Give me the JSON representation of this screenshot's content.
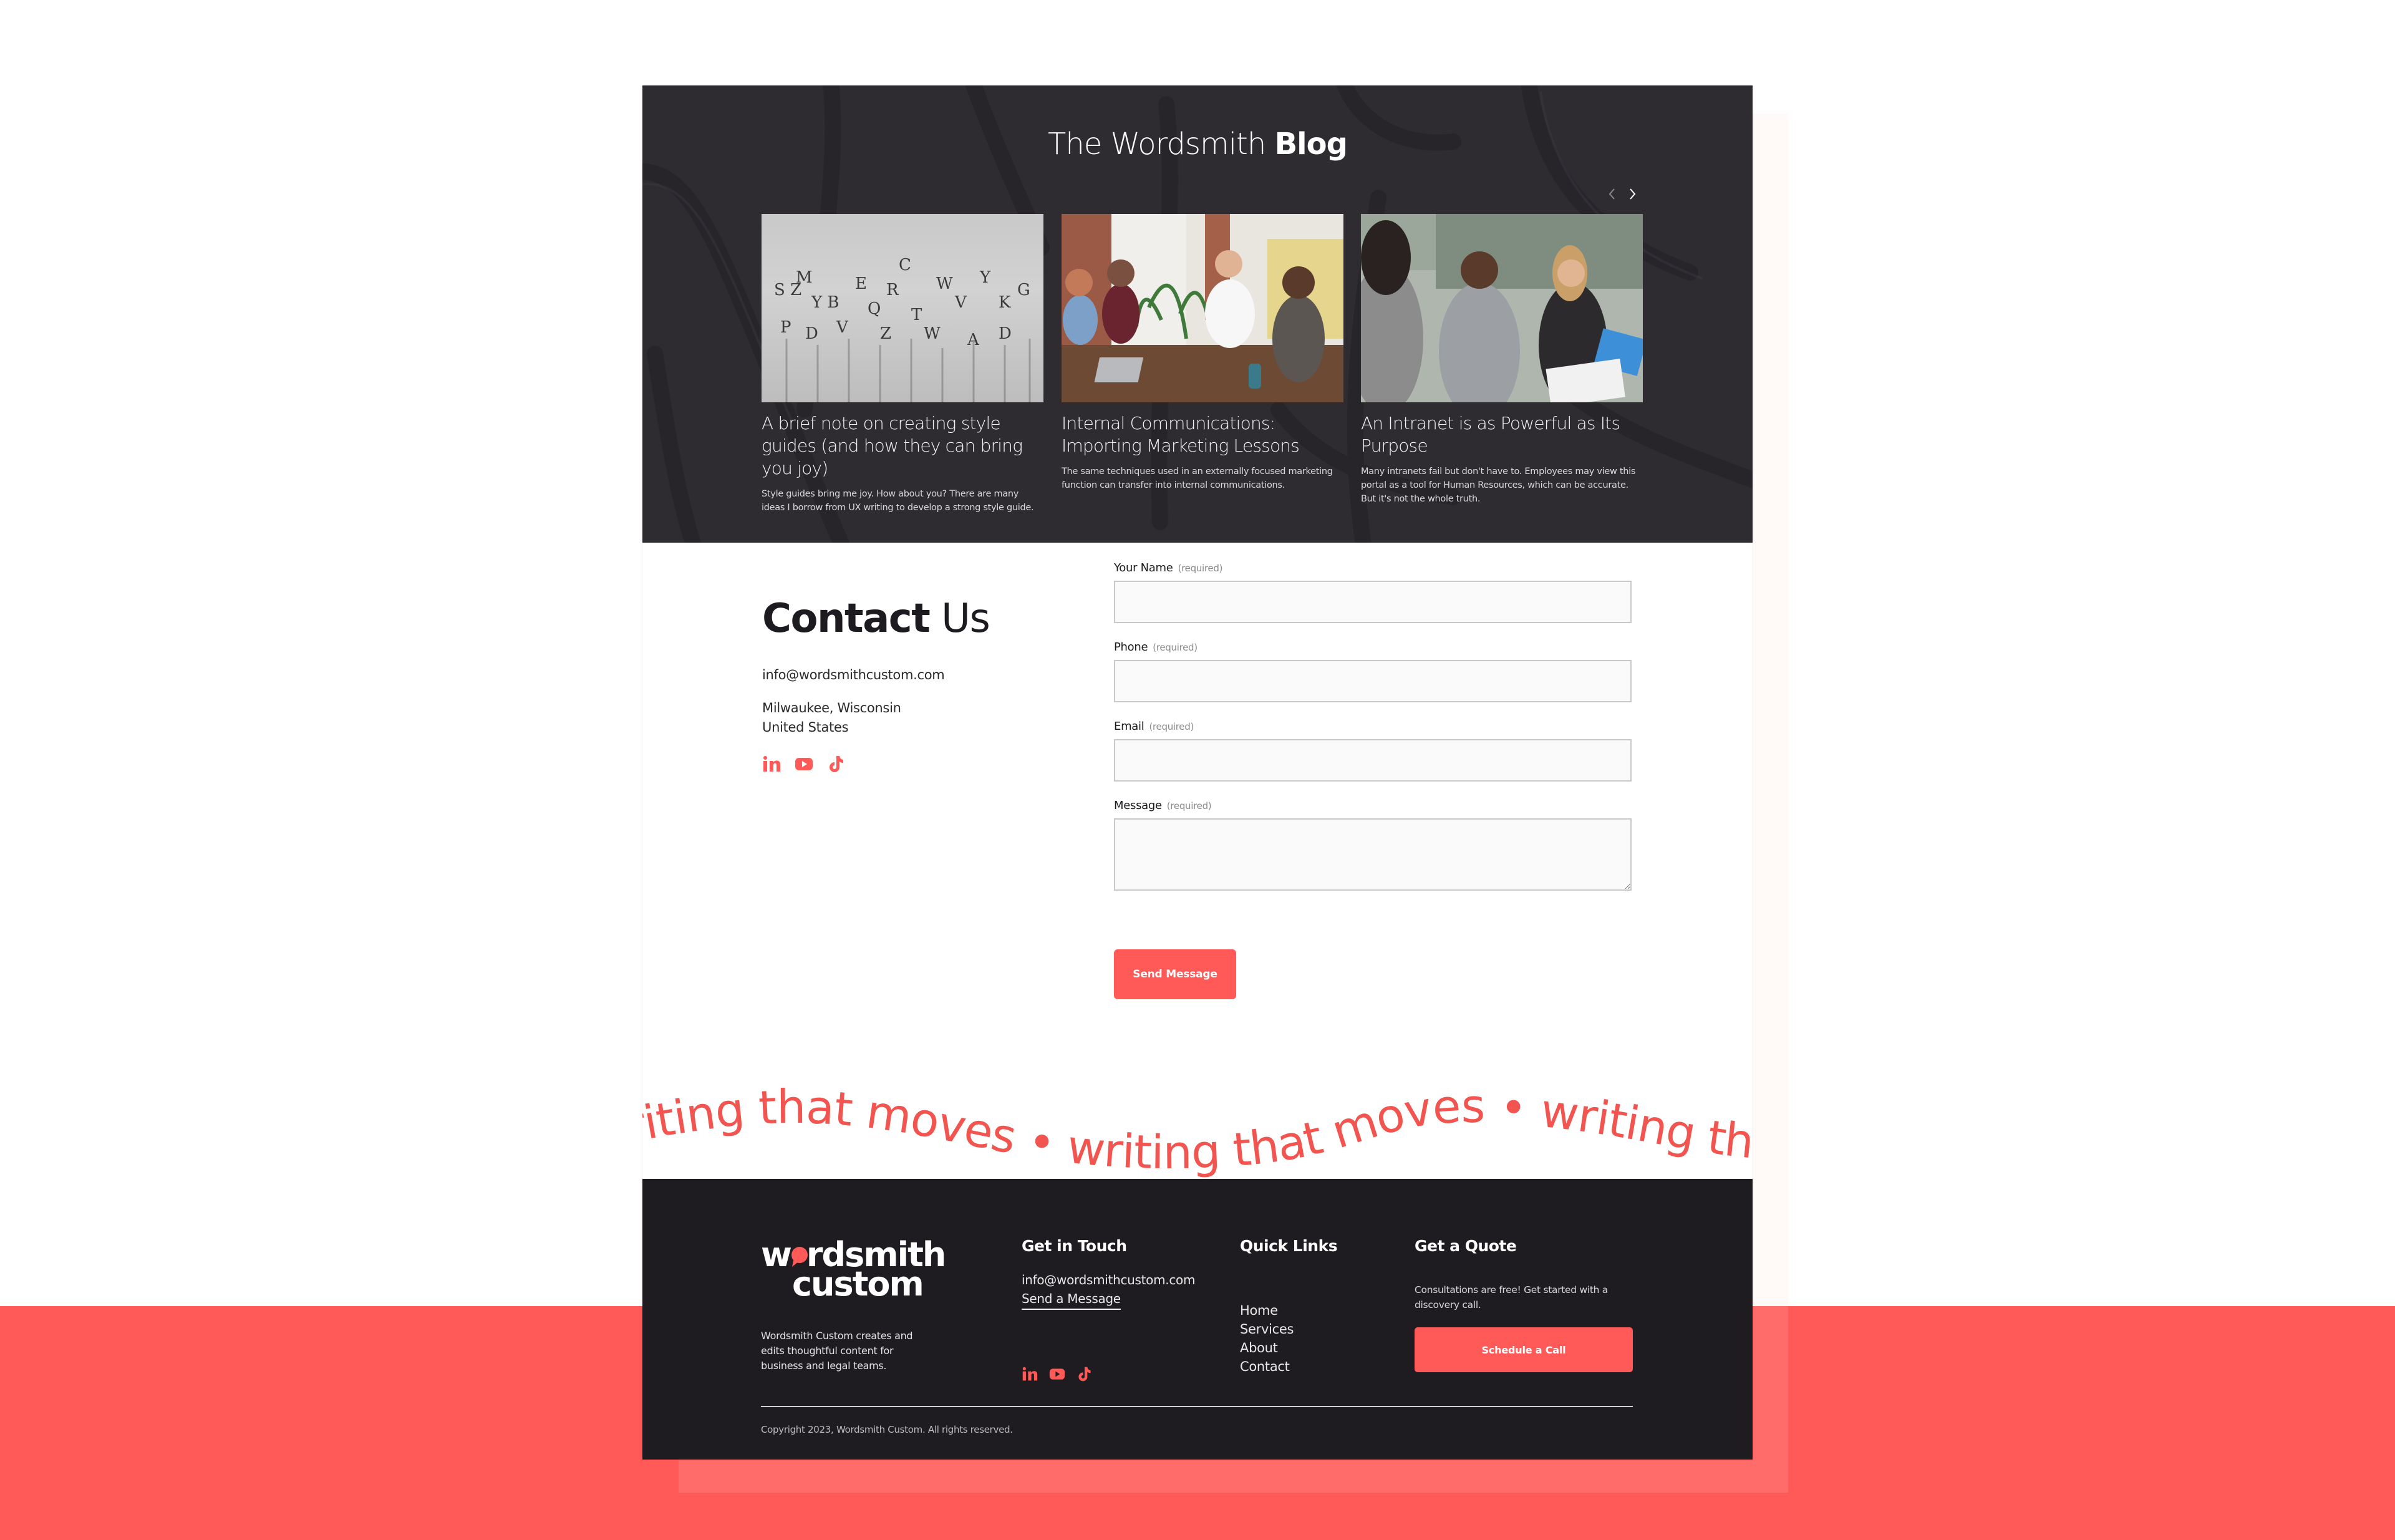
{
  "colors": {
    "accent": "#FF5A57",
    "blog_bg": "#2E2C31",
    "footer_bg": "#1E1C20",
    "text_dark": "#1D1B1F"
  },
  "blog": {
    "title_regular": "The Wordsmith",
    "title_bold": "Blog",
    "prev_icon": "chevron-left-icon",
    "next_icon": "chevron-right-icon",
    "posts": [
      {
        "title": "A brief note on creating style guides (and how they can bring you joy)",
        "excerpt": "Style guides bring me joy. How about you? There are many ideas I borrow from UX writing to develop a strong style guide.",
        "image": "scattered typeface letters"
      },
      {
        "title": "Internal Communications: Importing Marketing Lessons",
        "excerpt": "The same techniques used in an externally focused marketing function can transfer into internal communications.",
        "image": "team meeting around a wooden table"
      },
      {
        "title": "An Intranet is as Powerful as Its Purpose",
        "excerpt": "Many intranets fail but don't have to. Employees may view this portal as a tool for Human Resources, which can be accurate. But it's not the whole truth.",
        "image": "colleagues reviewing a document"
      }
    ]
  },
  "contact": {
    "title_bold": "Contact",
    "title_regular": "Us",
    "email": "info@wordsmithcustom.com",
    "address_line1": "Milwaukee, Wisconsin",
    "address_line2": "United States",
    "social": [
      "linkedin-icon",
      "youtube-icon",
      "tiktok-icon"
    ],
    "form": {
      "required_text": "(required)",
      "fields": [
        {
          "label": "Your Name",
          "value": "",
          "placeholder": ""
        },
        {
          "label": "Phone",
          "value": "",
          "placeholder": ""
        },
        {
          "label": "Email",
          "value": "",
          "placeholder": ""
        },
        {
          "label": "Message",
          "value": "",
          "placeholder": ""
        }
      ],
      "submit_label": "Send Message"
    }
  },
  "banner": {
    "text": "writing that moves",
    "separator": "•",
    "visible_text": "moves • writing that moves • writing that moves"
  },
  "footer": {
    "logo_line1": "wordsmith",
    "logo_line2": "custom",
    "description": "Wordsmith Custom creates and edits thoughtful content for business and legal teams.",
    "get_in_touch": {
      "heading": "Get in Touch",
      "email": "info@wordsmithcustom.com",
      "send_link": "Send a Message"
    },
    "quick_links": {
      "heading": "Quick Links",
      "links": [
        "Home",
        "Services",
        "About",
        "Contact"
      ]
    },
    "quote": {
      "heading": "Get a Quote",
      "text": "Consultations are free! Get started with a discovery call.",
      "button": "Schedule a Call"
    },
    "copyright": "Copyright 2023, Wordsmith Custom. All rights reserved."
  }
}
